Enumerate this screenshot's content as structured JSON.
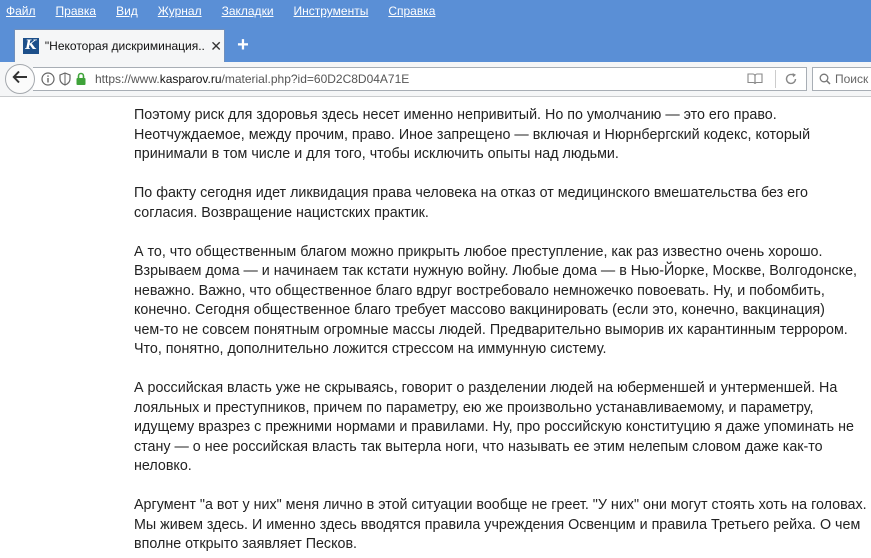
{
  "menu": {
    "items": [
      "Файл",
      "Правка",
      "Вид",
      "Журнал",
      "Закладки",
      "Инструменты",
      "Справка"
    ]
  },
  "tab": {
    "title": "\"Некоторая дискриминация...",
    "favicon_letter": "K",
    "new_tab_label": "+"
  },
  "navbar": {
    "url_prefix": "https://www.",
    "url_domain": "kasparov.ru",
    "url_path": "/material.php?id=60D2C8D04A71E",
    "search_placeholder": "Поиск"
  },
  "article": {
    "paragraphs": [
      "Поэтому риск для здоровья здесь несет именно непривитый. Но по умолчанию — это его право.\nНеотчуждаемое, между прочим, право. Иное запрещено — включая и Нюрнбергский кодекс, который\nпринимали в том числе и для того, чтобы исключить опыты над людьми.",
      "По факту сегодня идет ликвидация права человека на отказ от медицинского вмешательства без его\nсогласия. Возвращение нацистских практик.",
      "А то, что общественным благом можно прикрыть любое преступление, как раз известно очень хорошо.\nВзрываем дома — и начинаем так кстати нужную войну. Любые дома — в Нью-Йорке, Москве, Волгодонске,\nневажно. Важно, что общественное благо вдруг востребовало немножечко повоевать. Ну, и побомбить,\nконечно. Сегодня общественное благо требует массово вакцинировать (если это, конечно, вакцинация)\nчем-то не совсем понятным огромные массы людей. Предварительно выморив их карантинным террором.\nЧто, понятно, дополнительно ложится стрессом на иммунную систему.",
      "А российская власть уже не скрываясь, говорит о разделении людей на юберменшей и унтерменшей. На\nлояльных и преступников, причем по параметру, ею же произвольно устанавливаемому, и параметру,\nидущему вразрез с прежними нормами и правилами. Ну, про российскую конституцию я даже упоминать не\nстану — о нее российская власть так вытерла ноги, что называть ее этим нелепым словом даже как-то\nнеловко.",
      "Аргумент \"а вот у них\" меня лично в этой ситуации вообще не греет. \"У них\" они могут стоять хоть на головах.\nМы живем здесь. И именно здесь вводятся правила учреждения Освенцим и правила Третьего рейха. О чем\nвполне открыто заявляет Песков."
    ]
  },
  "colors": {
    "chrome_blue": "#5a8fd6",
    "toolbar_bg": "#f5f6f7",
    "text": "#222222",
    "lock_green": "#3fa33a"
  },
  "icons": [
    "back-arrow-icon",
    "info-icon",
    "shield-icon",
    "lock-icon",
    "reader-view-icon",
    "reload-icon",
    "search-icon",
    "close-icon"
  ]
}
